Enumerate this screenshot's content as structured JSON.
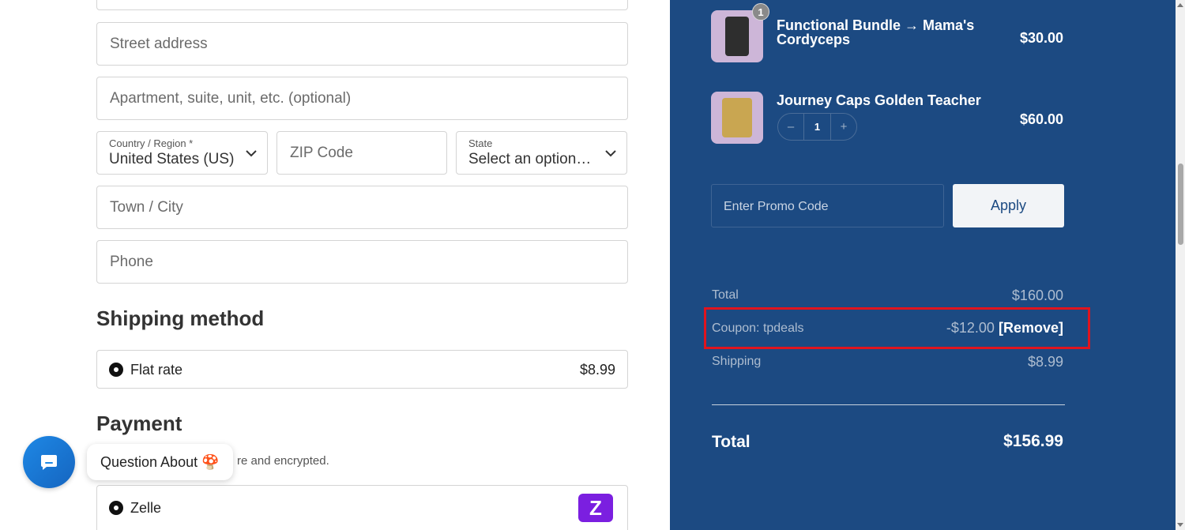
{
  "form": {
    "street_placeholder": "Street address",
    "apartment_placeholder": "Apartment, suite, unit, etc. (optional)",
    "country_label": "Country / Region *",
    "country_value": "United States (US)",
    "zip_placeholder": "ZIP Code",
    "state_label": "State",
    "state_value": "Select an option…",
    "town_placeholder": "Town / City",
    "phone_placeholder": "Phone"
  },
  "shipping": {
    "heading": "Shipping method",
    "option_label": "Flat rate",
    "option_price": "$8.99"
  },
  "payment": {
    "heading": "Payment",
    "secure_text": "re and encrypted.",
    "option_label": "Zelle",
    "zelle_logo": "Z"
  },
  "chat": {
    "bubble_text": "Question About 🍄"
  },
  "cart": {
    "items": [
      {
        "name_line1": "Functional Bundle → Mama's",
        "name_line2": "Cordyceps",
        "price": "$30.00",
        "badge": "1"
      },
      {
        "name_line1": "Journey Caps Golden Teacher",
        "price": "$60.00",
        "qty": "1",
        "minus": "–",
        "plus": "+"
      }
    ],
    "promo_placeholder": "Enter Promo Code",
    "apply_label": "Apply"
  },
  "summary": {
    "total_label": "Total",
    "total_value": "$160.00",
    "coupon_label": "Coupon: tpdeals",
    "coupon_value": "-$12.00",
    "remove_label": "[Remove]",
    "shipping_label": "Shipping",
    "shipping_value": "$8.99",
    "grand_label": "Total",
    "grand_value": "$156.99"
  },
  "colors": {
    "sidebar_bg": "#1c4a82",
    "highlight": "#e0141e",
    "zelle": "#7b1fe0",
    "chat_button": "#1e88e5"
  }
}
